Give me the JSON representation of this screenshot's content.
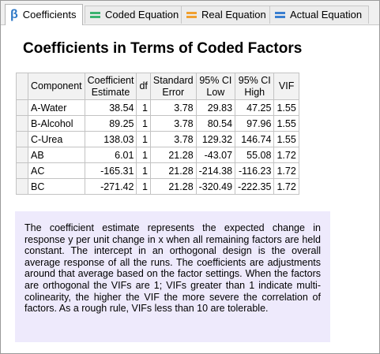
{
  "tabs": [
    {
      "label": "Coefficients",
      "icon": "beta-icon",
      "active": true
    },
    {
      "label": "Coded Equation",
      "icon": "equals-icon",
      "color": "#3cb371"
    },
    {
      "label": "Real Equation",
      "icon": "equals-icon",
      "color": "#f0a030"
    },
    {
      "label": "Actual Equation",
      "icon": "equals-icon",
      "color": "#3a7fd0"
    }
  ],
  "beta_glyph": "β",
  "title": "Coefficients in Terms of Coded Factors",
  "table": {
    "headers": [
      [
        "Component"
      ],
      [
        "Coefficient",
        "Estimate"
      ],
      [
        "df"
      ],
      [
        "Standard",
        "Error"
      ],
      [
        "95% CI",
        "Low"
      ],
      [
        "95% CI",
        "High"
      ],
      [
        "VIF"
      ]
    ],
    "rows": [
      [
        "A-Water",
        "38.54",
        "1",
        "3.78",
        "29.83",
        "47.25",
        "1.55"
      ],
      [
        "B-Alcohol",
        "89.25",
        "1",
        "3.78",
        "80.54",
        "97.96",
        "1.55"
      ],
      [
        "C-Urea",
        "138.03",
        "1",
        "3.78",
        "129.32",
        "146.74",
        "1.55"
      ],
      [
        "AB",
        "6.01",
        "1",
        "21.28",
        "-43.07",
        "55.08",
        "1.72"
      ],
      [
        "AC",
        "-165.31",
        "1",
        "21.28",
        "-214.38",
        "-116.23",
        "1.72"
      ],
      [
        "BC",
        "-271.42",
        "1",
        "21.28",
        "-320.49",
        "-222.35",
        "1.72"
      ]
    ]
  },
  "note": "The coefficient estimate represents the expected change in response y per unit change in x when all remaining factors are held constant. The intercept in an orthogonal design is the overall average response of all the runs. The coefficients are adjustments around that average based on the factor settings. When the factors are orthogonal the VIFs are 1; VIFs greater than 1 indicate multi-colinearity, the higher the VIF the more severe the correlation of factors. As a rough rule, VIFs less than 10 are tolerable."
}
